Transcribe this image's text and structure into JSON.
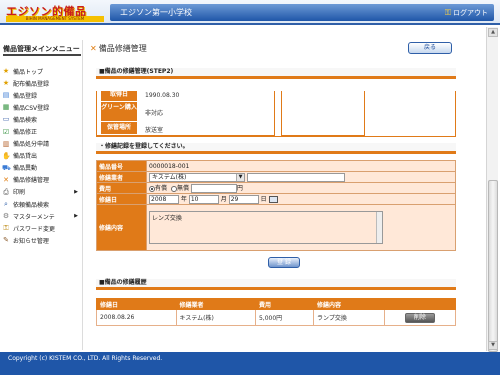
{
  "header": {
    "logo_main": "エジソン的備品",
    "logo_sub": "BIHIN MANAGEMENT SYSTEM",
    "school": "エジソン第一小学校",
    "logout": "ログアウト"
  },
  "sidebar": {
    "title": "備品管理メインメニュー",
    "items": [
      {
        "label": "備品トップ",
        "icon": "star-icon",
        "arrow": false
      },
      {
        "label": "配布備品登録",
        "icon": "star-icon",
        "arrow": false
      },
      {
        "label": "備品登録",
        "icon": "document-icon",
        "arrow": false
      },
      {
        "label": "備品CSV登録",
        "icon": "csv-icon",
        "arrow": false
      },
      {
        "label": "備品検索",
        "icon": "monitor-icon",
        "arrow": false
      },
      {
        "label": "備品修正",
        "icon": "checkbox-icon",
        "arrow": false
      },
      {
        "label": "備品処分申請",
        "icon": "book-icon",
        "arrow": false
      },
      {
        "label": "備品貸出",
        "icon": "hand-icon",
        "arrow": false
      },
      {
        "label": "備品異動",
        "icon": "truck-icon",
        "arrow": false
      },
      {
        "label": "備品修繕管理",
        "icon": "tools-icon",
        "arrow": false
      },
      {
        "label": "印刷",
        "icon": "printer-icon",
        "arrow": true
      },
      {
        "label": "依頼備品検索",
        "icon": "search-icon",
        "arrow": false
      },
      {
        "label": "マスターメンテ",
        "icon": "gear-icon",
        "arrow": true
      },
      {
        "label": "パスワード変更",
        "icon": "key-icon",
        "arrow": false
      },
      {
        "label": "お知らせ管理",
        "icon": "pencil-icon",
        "arrow": false
      }
    ]
  },
  "main": {
    "title": "備品修繕管理",
    "back": "戻る",
    "info_header": "■備品の修繕管理(STEP2)",
    "info": {
      "acq_label": "取得日",
      "acq_value": "1990.08.30",
      "green_label": "グリーン購入",
      "green_value": "非対応",
      "place_label": "保管場所",
      "place_value": "放送室"
    },
    "form_header": "・修繕記録を登録してください。",
    "form": {
      "number_label": "備品番号",
      "number_value": "0000018-001",
      "vendor_label": "修繕業者",
      "vendor_value": "キステム(株)",
      "vendor_extra": "",
      "cost_label": "費用",
      "cost_paid": "有償",
      "cost_free": "無償",
      "cost_value": "",
      "cost_unit": "円",
      "date_label": "修繕日",
      "year": "2008",
      "year_unit": "年",
      "month": "10",
      "month_unit": "月",
      "day": "29",
      "day_unit": "日",
      "content_label": "修繕内容",
      "content_value": "レンズ交換"
    },
    "register": "登 録",
    "history_header": "■備品の修繕履歴",
    "history": {
      "cols": [
        "修繕日",
        "修繕業者",
        "費用",
        "修繕内容",
        ""
      ],
      "rows": [
        [
          "2008.08.26",
          "キステム(株)",
          "5,000円",
          "ランプ交換"
        ]
      ],
      "delete": "削除"
    }
  },
  "footer": "Copyright (c) KISTEM CO., LTD. All Rights Reserved.",
  "colors": {
    "accent": "#e07a18",
    "brand_blue": "#1f56a8",
    "form_bg": "#ffe8d8"
  }
}
